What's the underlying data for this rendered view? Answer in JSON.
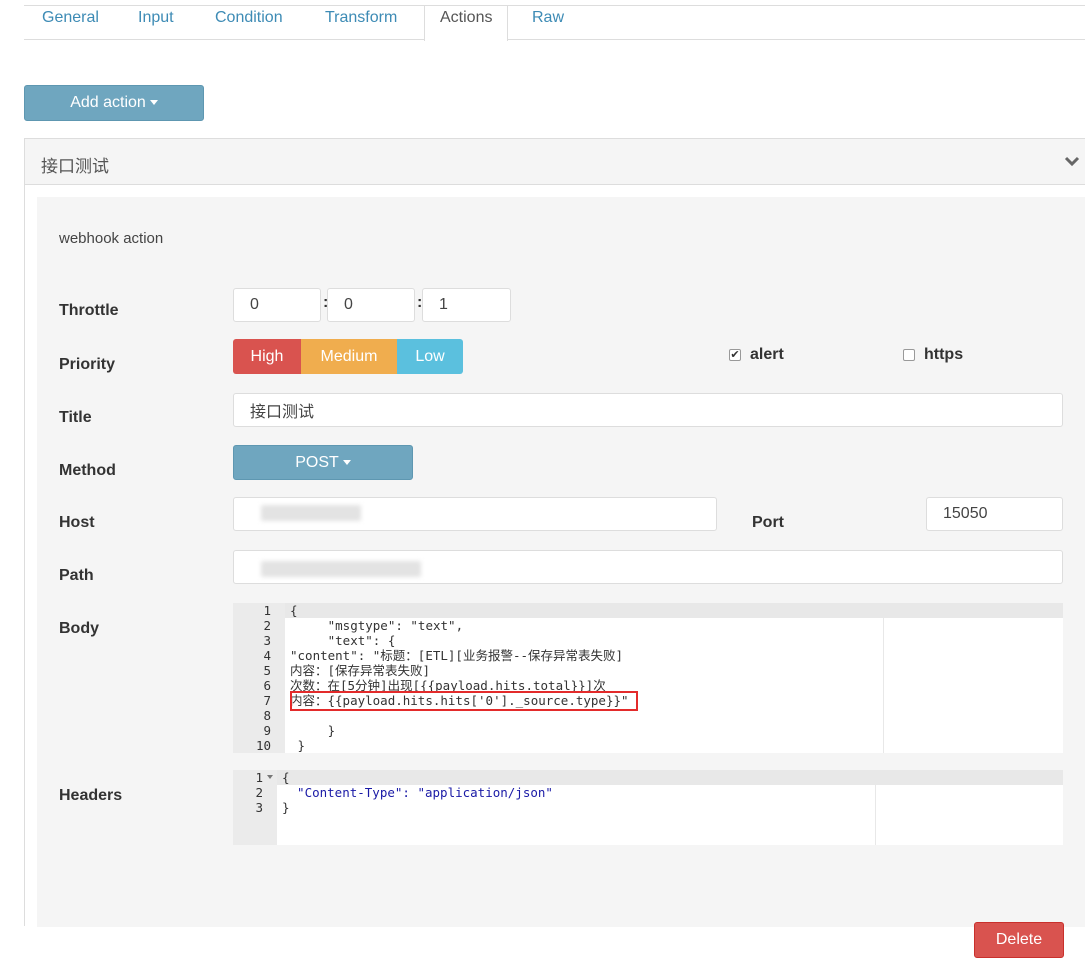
{
  "tabs": [
    {
      "label": "General"
    },
    {
      "label": "Input"
    },
    {
      "label": "Condition"
    },
    {
      "label": "Transform"
    },
    {
      "label": "Actions",
      "active": true
    },
    {
      "label": "Raw"
    }
  ],
  "add_action_label": "Add action",
  "panel": {
    "title": "接口测试",
    "section_label": "webhook action",
    "throttle": {
      "label": "Throttle",
      "values": [
        "0",
        "0",
        "1"
      ]
    },
    "priority": {
      "label": "Priority",
      "options": [
        {
          "label": "High",
          "color": "#d9534f"
        },
        {
          "label": "Medium",
          "color": "#f0ad4e"
        },
        {
          "label": "Low",
          "color": "#5bc0de"
        }
      ]
    },
    "alert": {
      "label": "alert",
      "checked": true
    },
    "https": {
      "label": "https",
      "checked": false
    },
    "title_field": {
      "label": "Title",
      "value": "接口测试"
    },
    "method": {
      "label": "Method",
      "value": "POST"
    },
    "host": {
      "label": "Host",
      "value": ""
    },
    "port": {
      "label": "Port",
      "value": "15050"
    },
    "path": {
      "label": "Path",
      "value": ""
    },
    "body": {
      "label": "Body",
      "lines": [
        {
          "n": "1",
          "text": "{"
        },
        {
          "n": "2",
          "text": "     \"msgtype\": \"text\","
        },
        {
          "n": "3",
          "text": "     \"text\": {"
        },
        {
          "n": "4",
          "text": "\"content\": \"标题：[ETL][业务报警--保存异常表失败]"
        },
        {
          "n": "5",
          "text": "内容：[保存异常表失败]"
        },
        {
          "n": "6",
          "text": "次数：在[5分钟]出现[{{payload.hits.total}}]次"
        },
        {
          "n": "7",
          "text": "内容：{{payload.hits.hits['0']._source.type}}\""
        },
        {
          "n": "8",
          "text": ""
        },
        {
          "n": "9",
          "text": "     }"
        },
        {
          "n": "10",
          "text": " }"
        }
      ]
    },
    "headers": {
      "label": "Headers",
      "lines": [
        {
          "n": "1",
          "text": "{"
        },
        {
          "n": "2",
          "text": "  \"Content-Type\": \"application/json\""
        },
        {
          "n": "3",
          "text": "}"
        }
      ]
    },
    "delete_label": "Delete"
  },
  "colors": {
    "tab_link": "#3d8bb5",
    "button_primary": "#6fa6bf",
    "danger": "#d9534f",
    "highlight_box": "#e32b2b"
  }
}
